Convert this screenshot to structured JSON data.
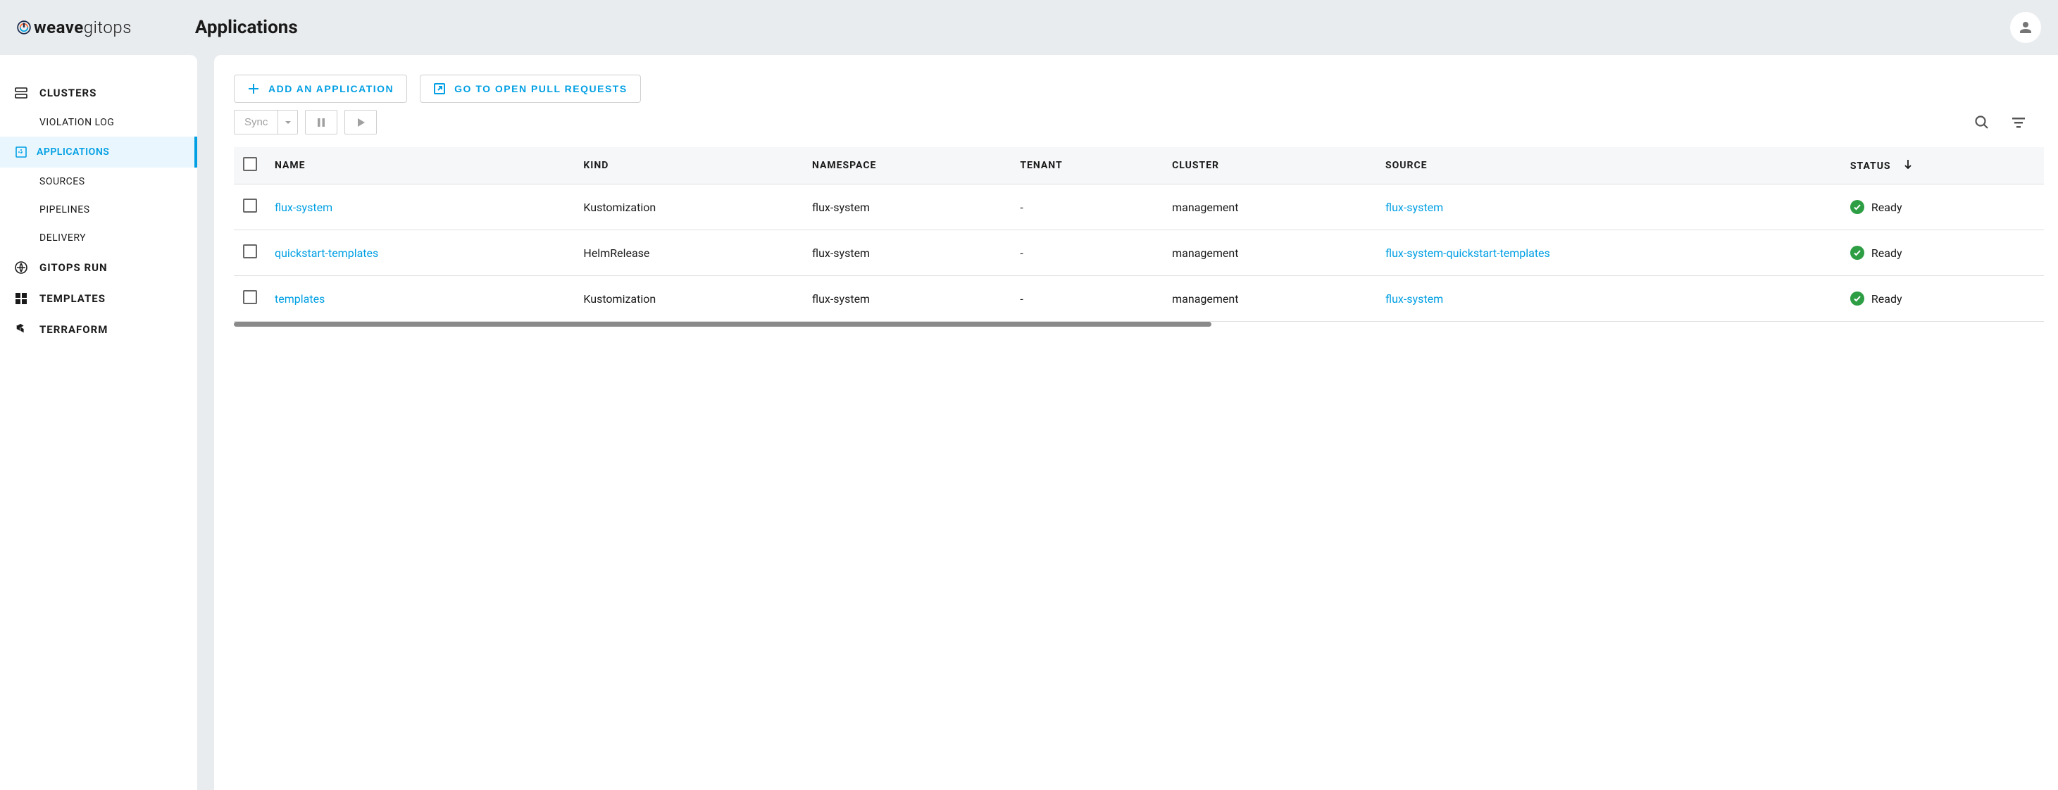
{
  "brand": {
    "bold": "weave",
    "light": "gitops"
  },
  "header": {
    "title": "Applications"
  },
  "sidebar": {
    "items": [
      {
        "label": "CLUSTERS",
        "icon": "clusters-icon",
        "type": "top"
      },
      {
        "label": "VIOLATION LOG",
        "type": "sub"
      },
      {
        "label": "APPLICATIONS",
        "icon": "applications-icon",
        "type": "sub-icon",
        "active": true
      },
      {
        "label": "SOURCES",
        "type": "sub"
      },
      {
        "label": "PIPELINES",
        "type": "sub"
      },
      {
        "label": "DELIVERY",
        "type": "sub"
      },
      {
        "label": "GITOPS RUN",
        "icon": "gitops-run-icon",
        "type": "top"
      },
      {
        "label": "TEMPLATES",
        "icon": "templates-icon",
        "type": "top"
      },
      {
        "label": "TERRAFORM",
        "icon": "terraform-icon",
        "type": "top"
      }
    ]
  },
  "toolbar": {
    "add_label": "ADD AN APPLICATION",
    "open_pr_label": "GO TO OPEN PULL REQUESTS",
    "sync_label": "Sync"
  },
  "table": {
    "columns": [
      "NAME",
      "KIND",
      "NAMESPACE",
      "TENANT",
      "CLUSTER",
      "SOURCE",
      "STATUS"
    ],
    "sort_column": "STATUS",
    "rows": [
      {
        "name": "flux-system",
        "kind": "Kustomization",
        "namespace": "flux-system",
        "tenant": "-",
        "cluster": "management",
        "source": "flux-system",
        "status": "Ready"
      },
      {
        "name": "quickstart-templates",
        "kind": "HelmRelease",
        "namespace": "flux-system",
        "tenant": "-",
        "cluster": "management",
        "source": "flux-system-quickstart-templates",
        "status": "Ready"
      },
      {
        "name": "templates",
        "kind": "Kustomization",
        "namespace": "flux-system",
        "tenant": "-",
        "cluster": "management",
        "source": "flux-system",
        "status": "Ready"
      }
    ]
  }
}
